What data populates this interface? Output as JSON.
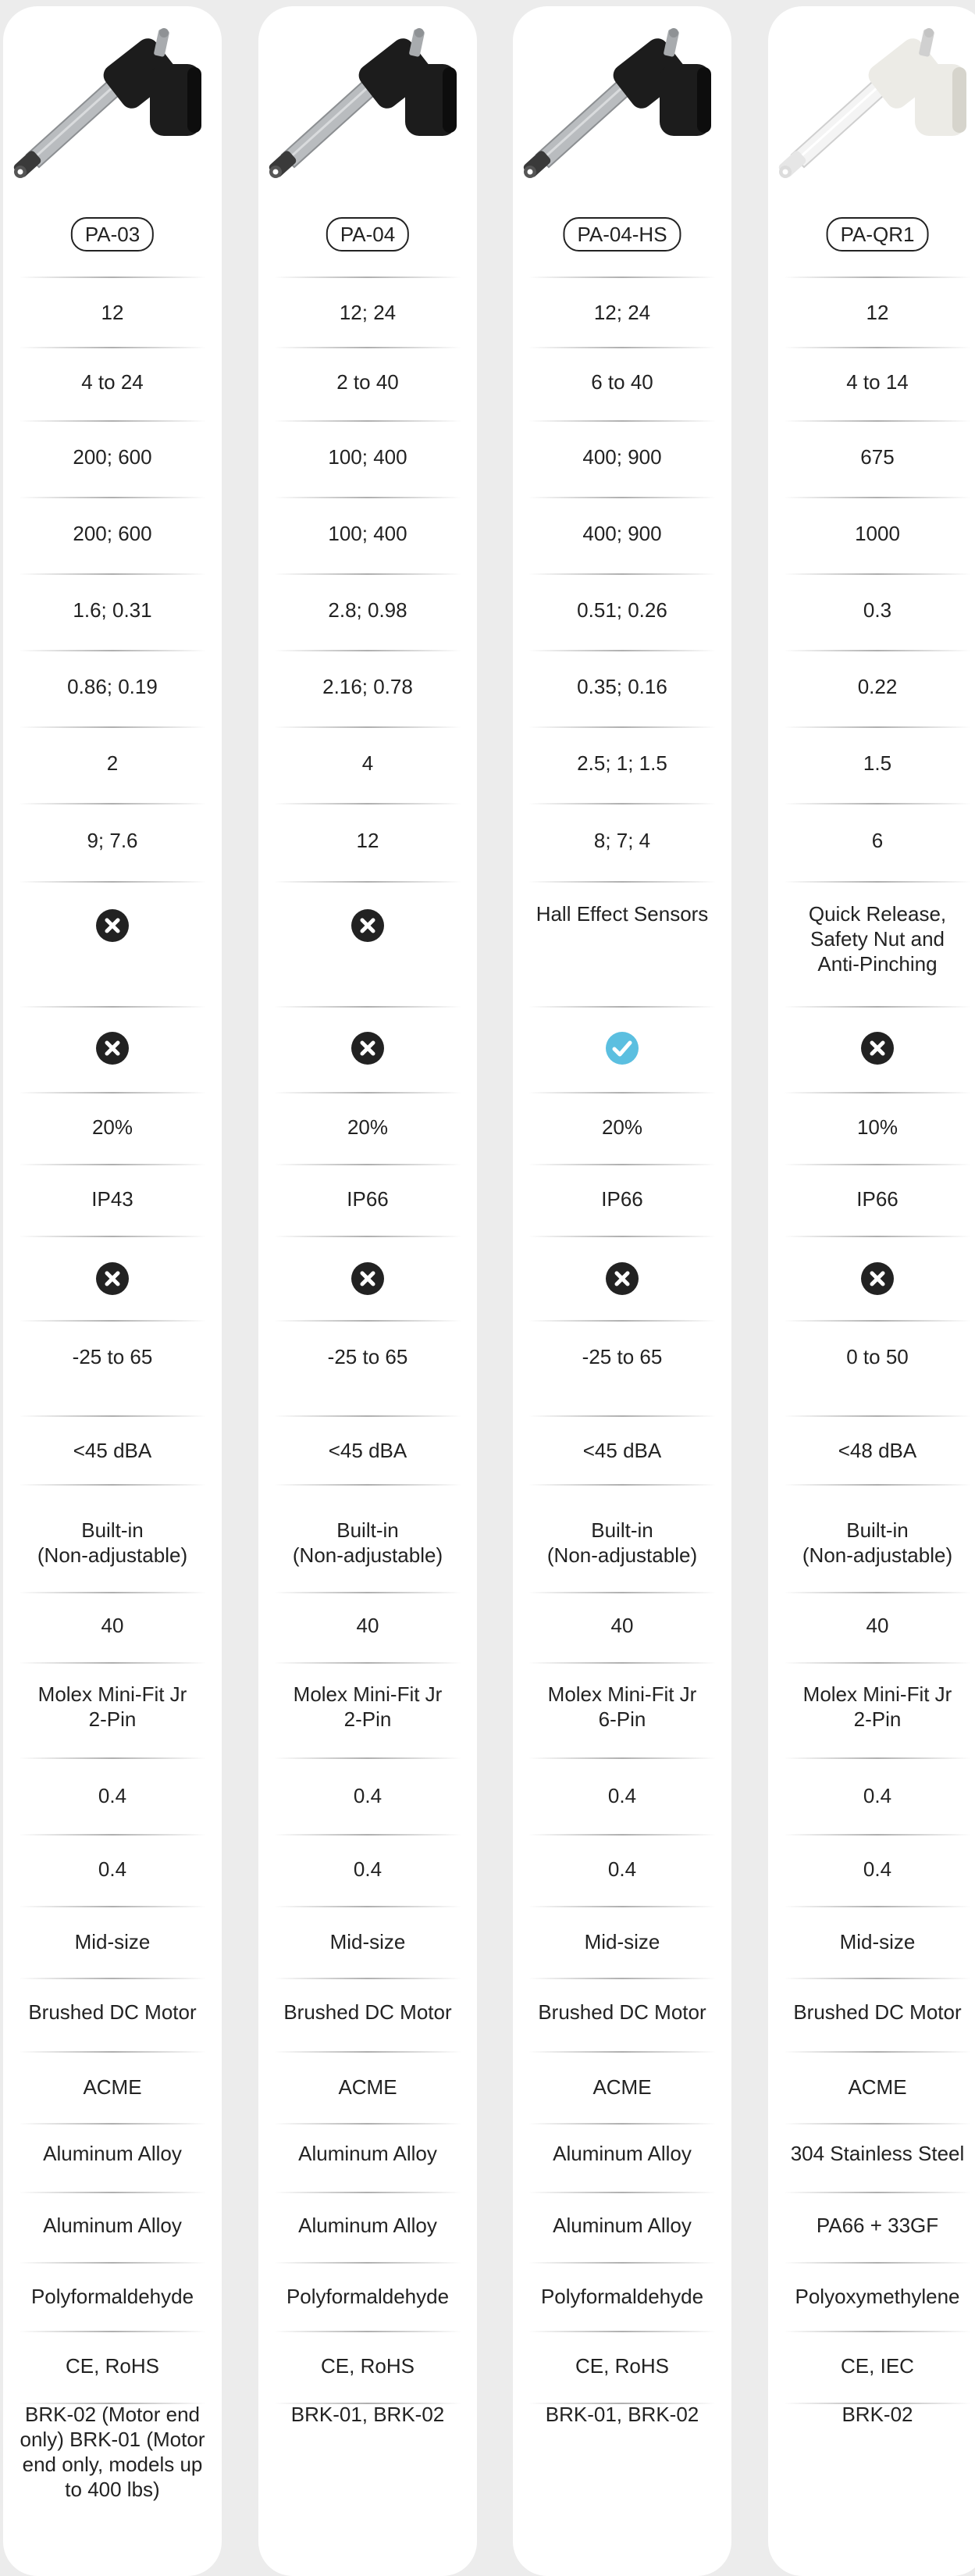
{
  "colors": {
    "page_background": "#ececec",
    "card_background": "#ffffff",
    "x_icon": "#222222",
    "check_icon": "#5bbfe0"
  },
  "products": [
    {
      "name": "PA-03",
      "image": "gray-actuator-black-motor",
      "rows": [
        "12",
        "4 to 24",
        "200; 600",
        "200; 600",
        "1.6; 0.31",
        "0.86; 0.19",
        "2",
        "9; 7.6",
        "x-icon",
        "x-icon",
        "20%",
        "IP43",
        "x-icon",
        "-25 to 65",
        "<45 dBA",
        "Built-in\n(Non-adjustable)",
        "40",
        "Molex Mini-Fit Jr\n2-Pin",
        "0.4",
        "0.4",
        "Mid-size",
        "Brushed DC Motor",
        "ACME",
        "Aluminum Alloy",
        "Aluminum Alloy",
        "Polyformaldehyde",
        "CE, RoHS",
        "BRK-02 (Motor end\nonly) BRK-01 (Motor\nend only, models up\nto 400 lbs)"
      ]
    },
    {
      "name": "PA-04",
      "image": "gray-actuator-black-motor",
      "rows": [
        "12; 24",
        "2 to 40",
        "100; 400",
        "100; 400",
        "2.8; 0.98",
        "2.16; 0.78",
        "4",
        "12",
        "x-icon",
        "x-icon",
        "20%",
        "IP66",
        "x-icon",
        "-25 to 65",
        "<45 dBA",
        "Built-in\n(Non-adjustable)",
        "40",
        "Molex Mini-Fit Jr\n2-Pin",
        "0.4",
        "0.4",
        "Mid-size",
        "Brushed DC Motor",
        "ACME",
        "Aluminum Alloy",
        "Aluminum Alloy",
        "Polyformaldehyde",
        "CE, RoHS",
        "BRK-01, BRK-02"
      ]
    },
    {
      "name": "PA-04-HS",
      "image": "gray-actuator-black-motor",
      "rows": [
        "12; 24",
        "6 to 40",
        "400; 900",
        "400; 900",
        "0.51; 0.26",
        "0.35; 0.16",
        "2.5; 1; 1.5",
        "8; 7; 4",
        "Hall Effect Sensors",
        "check-icon",
        "20%",
        "IP66",
        "x-icon",
        "-25 to 65",
        "<45 dBA",
        "Built-in\n(Non-adjustable)",
        "40",
        "Molex Mini-Fit Jr\n6-Pin",
        "0.4",
        "0.4",
        "Mid-size",
        "Brushed DC Motor",
        "ACME",
        "Aluminum Alloy",
        "Aluminum Alloy",
        "Polyformaldehyde",
        "CE, RoHS",
        "BRK-01, BRK-02"
      ]
    },
    {
      "name": "PA-QR1",
      "image": "white-actuator-cream-motor",
      "rows": [
        "12",
        "4 to 14",
        "675",
        "1000",
        "0.3",
        "0.22",
        "1.5",
        "6",
        "Quick Release,\nSafety Nut and\nAnti-Pinching",
        "x-icon",
        "10%",
        "IP66",
        "x-icon",
        "0 to 50",
        "<48 dBA",
        "Built-in\n(Non-adjustable)",
        "40",
        "Molex Mini-Fit Jr\n2-Pin",
        "0.4",
        "0.4",
        "Mid-size",
        "Brushed DC Motor",
        "ACME",
        "304 Stainless Steel",
        "PA66 + 33GF",
        "Polyoxymethylene",
        "CE, IEC",
        "BRK-02"
      ]
    }
  ]
}
